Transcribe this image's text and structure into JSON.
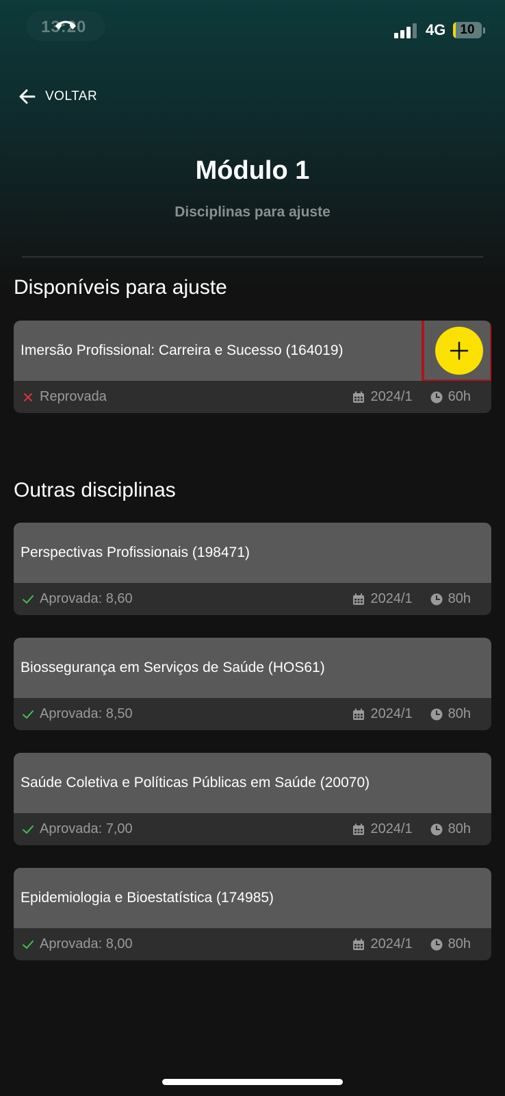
{
  "status_bar": {
    "time": "13:20",
    "network": "4G",
    "battery": "10",
    "battery_level": 0.1
  },
  "header": {
    "back_label": "VOLTAR",
    "title": "Módulo 1",
    "subtitle": "Disciplinas para ajuste"
  },
  "sections": [
    {
      "title": "Disponíveis para ajuste",
      "courses": [
        {
          "name": "Imersão Profissional: Carreira e Sucesso (164019)",
          "status": "Reprovada",
          "status_type": "failed",
          "period": "2024/1",
          "hours": "60h",
          "add_icon": "plus-icon"
        }
      ]
    },
    {
      "title": "Outras disciplinas",
      "courses": [
        {
          "name": "Perspectivas Profissionais (198471)",
          "status": "Aprovada: 8,60",
          "status_type": "approved",
          "period": "2024/1",
          "hours": "80h"
        },
        {
          "name": "Biossegurança em Serviços de Saúde (HOS61)",
          "status": "Aprovada: 8,50",
          "status_type": "approved",
          "period": "2024/1",
          "hours": "80h"
        },
        {
          "name": "Saúde Coletiva e Políticas Públicas em Saúde (20070)",
          "status": "Aprovada: 7,00",
          "status_type": "approved",
          "period": "2024/1",
          "hours": "80h"
        },
        {
          "name": "Epidemiologia e Bioestatística (174985)",
          "status": "Aprovada: 8,00",
          "status_type": "approved",
          "period": "2024/1",
          "hours": "80h"
        }
      ]
    }
  ],
  "colors": {
    "accent_add": "#fae100",
    "highlight": "#b0151c",
    "approved": "#3fc44f",
    "failed": "#e0313b"
  }
}
